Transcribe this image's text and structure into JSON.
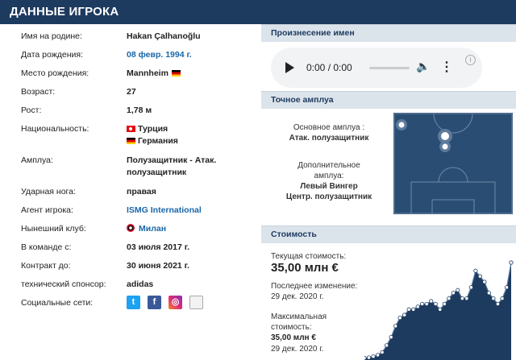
{
  "header": {
    "title": "ДАННЫЕ ИГРОКА"
  },
  "player": {
    "rows": {
      "name_native": {
        "label": "Имя на родине:",
        "value": "Hakan Çalhanoğlu"
      },
      "birth_date": {
        "label": "Дата рождения:",
        "value": "08 февр. 1994 г."
      },
      "birth_place": {
        "label": "Место рождения:",
        "value": "Mannheim"
      },
      "age": {
        "label": "Возраст:",
        "value": "27"
      },
      "height": {
        "label": "Рост:",
        "value": "1,78 м"
      },
      "nationality": {
        "label": "Национальность:",
        "value1": "Турция",
        "value2": "Германия"
      },
      "position": {
        "label": "Амплуа:",
        "value_line1": "Полузащитник - Атак.",
        "value_line2": "полузащитник"
      },
      "foot": {
        "label": "Ударная нога:",
        "value": "правая"
      },
      "agent": {
        "label": "Агент игрока:",
        "value": "ISMG International"
      },
      "club": {
        "label": "Нынешний клуб:",
        "value": "Милан"
      },
      "joined": {
        "label": "В команде с:",
        "value": "03 июля 2017 г."
      },
      "contract": {
        "label": "Контракт до:",
        "value": "30 июня 2021 г."
      },
      "sponsor": {
        "label": "технический спонсор:",
        "value": "adidas"
      },
      "social": {
        "label": "Социальные сети:",
        "icons": [
          "twitter-icon",
          "facebook-icon",
          "instagram-icon",
          "broken-image-icon"
        ]
      }
    }
  },
  "pronunciation": {
    "title": "Произнесение имен",
    "time": "0:00 / 0:00"
  },
  "position_box": {
    "title": "Точное амплуа",
    "main_label": "Основное амплуа :",
    "main_value": "Атак. полузащитник",
    "other_label_line1": "Дополнительное",
    "other_label_line2": "амплуа:",
    "other_value1": "Левый Вингер",
    "other_value2": "Центр. полузащитник"
  },
  "market": {
    "title": "Стоимость",
    "current_label": "Текущая стоимость:",
    "current_value": "35,00 млн €",
    "last_change_label": "Последнее изменение:",
    "last_change_date": "29 дек. 2020 г.",
    "max_label_line1": "Максимальная",
    "max_label_line2": "стоимость:",
    "max_value": "35,00 млн €",
    "max_date": "29 дек. 2020 г."
  },
  "colors": {
    "header_bg": "#1d3a5f",
    "section_bg": "#dbe3eb",
    "link": "#1a67a8",
    "pitch": "#2a4d74",
    "chart_fill": "#1d3a5f"
  },
  "chart_data": {
    "type": "area",
    "title": "",
    "xlabel": "",
    "ylabel": "",
    "series": [
      {
        "values": [
          0.4,
          0.6,
          1.0,
          1.5,
          2.5,
          5,
          8,
          12,
          15,
          16,
          18,
          18,
          19,
          20,
          20,
          21,
          20,
          18,
          20,
          22,
          24,
          25,
          22,
          22,
          26,
          32,
          30,
          28,
          24,
          22,
          20,
          22,
          26,
          35
        ]
      }
    ],
    "grid": false
  }
}
